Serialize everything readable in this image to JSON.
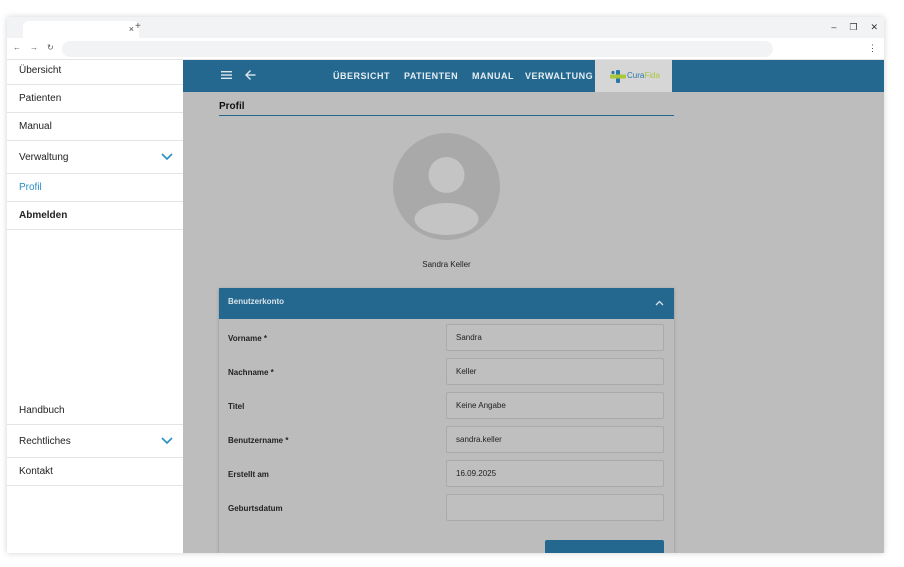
{
  "browser": {
    "tab_close": "×",
    "new_tab": "+",
    "window_controls": [
      "–",
      "❐",
      "✕"
    ],
    "nav": [
      "←",
      "→",
      "↻"
    ],
    "menu": "⋮"
  },
  "sidebar": {
    "items": [
      {
        "label": "Übersicht"
      },
      {
        "label": "Patienten"
      },
      {
        "label": "Manual"
      },
      {
        "label": "Verwaltung"
      },
      {
        "label": "Profil"
      },
      {
        "label": "Abmelden"
      },
      {
        "label": "Handbuch"
      },
      {
        "label": "Rechtliches"
      },
      {
        "label": "Kontakt"
      }
    ]
  },
  "topnav": {
    "links": [
      "ÜBERSICHT",
      "PATIENTEN",
      "MANUAL",
      "VERWALTUNG"
    ],
    "logo_part1": "Cura",
    "logo_part2": "Fida"
  },
  "page": {
    "title": "Profil",
    "user_name": "Sandra Keller"
  },
  "account": {
    "header": "Benutzerkonto",
    "fields": [
      {
        "label": "Vorname *",
        "value": "Sandra"
      },
      {
        "label": "Nachname *",
        "value": "Keller"
      },
      {
        "label": "Titel",
        "value": "Keine Angabe"
      },
      {
        "label": "Benutzername *",
        "value": "sandra.keller"
      },
      {
        "label": "Erstellt am",
        "value": "16.09.2025"
      },
      {
        "label": "Geburtsdatum",
        "value": ""
      }
    ]
  },
  "colors": {
    "primary": "#24688f",
    "active_link": "#2a8dc4",
    "overlay": "#bdbdbd",
    "logo_blue": "#2a76a8",
    "logo_green": "#a8c83a"
  }
}
